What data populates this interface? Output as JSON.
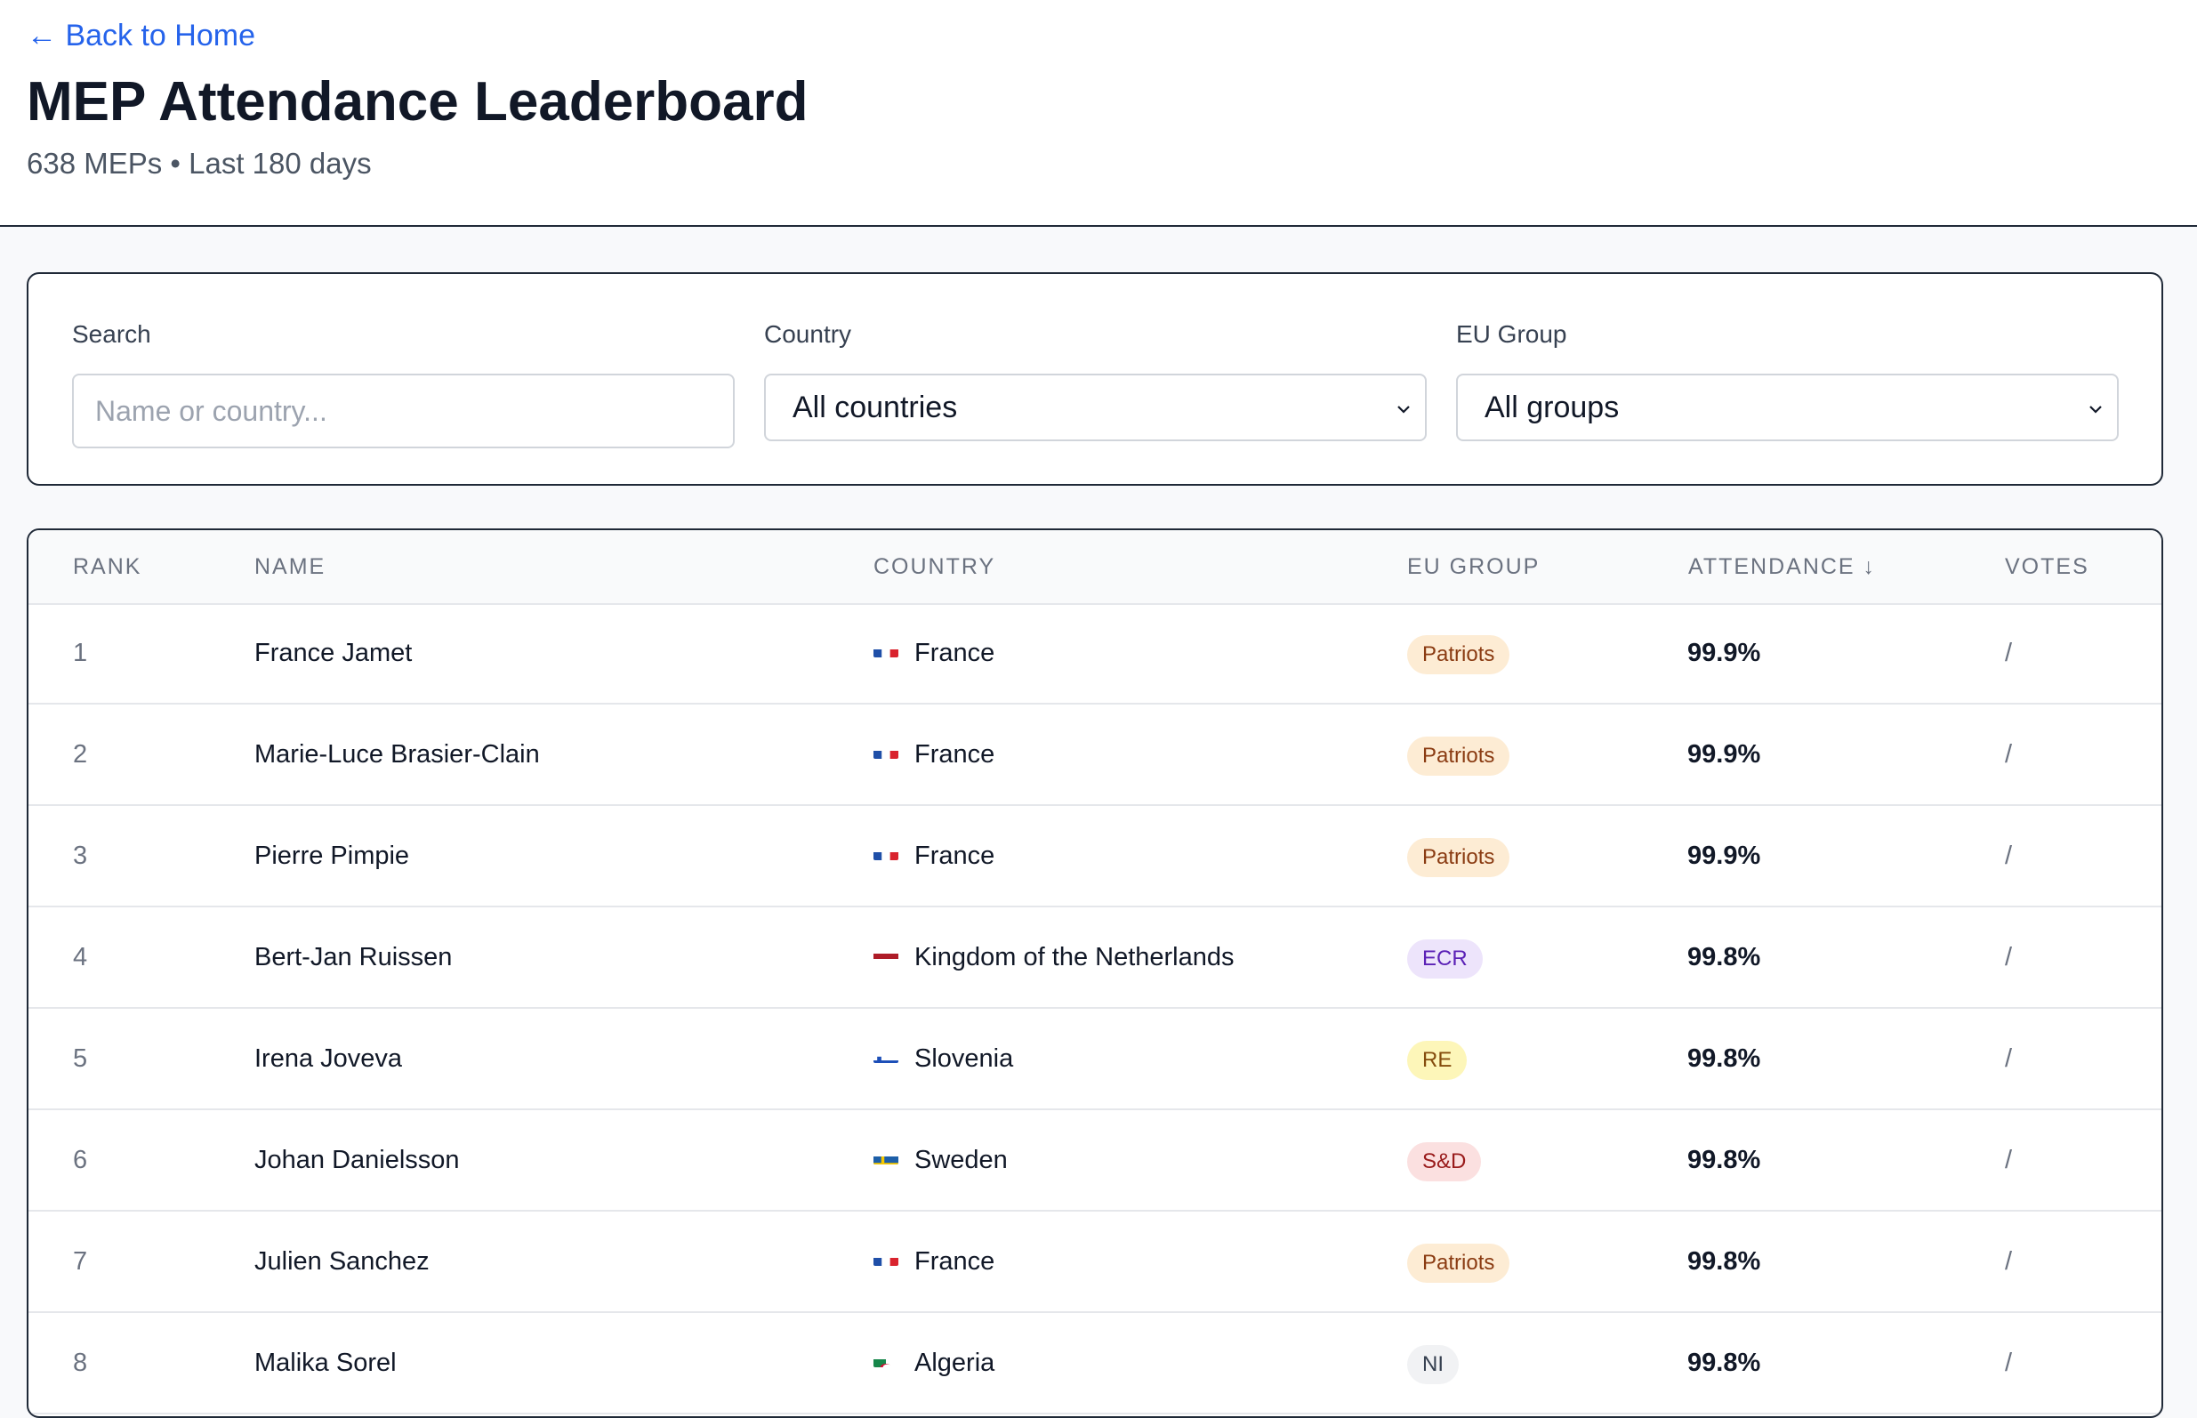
{
  "header": {
    "back_label": "← Back to Home",
    "title": "MEP Attendance Leaderboard",
    "subtitle": "638 MEPs • Last 180 days"
  },
  "filters": {
    "search_label": "Search",
    "search_placeholder": "Name or country...",
    "search_value": "",
    "country_label": "Country",
    "country_selected": "All countries",
    "group_label": "EU Group",
    "group_selected": "All groups"
  },
  "table": {
    "columns": [
      "RANK",
      "NAME",
      "COUNTRY",
      "EU GROUP",
      "ATTENDANCE ↓",
      "VOTES"
    ],
    "rows": [
      {
        "rank": "1",
        "name": "France Jamet",
        "flag": "flag-fr",
        "country": "France",
        "group": "Patriots",
        "attendance": "99.9%",
        "votes": "/"
      },
      {
        "rank": "2",
        "name": "Marie-Luce Brasier-Clain",
        "flag": "flag-fr",
        "country": "France",
        "group": "Patriots",
        "attendance": "99.9%",
        "votes": "/"
      },
      {
        "rank": "3",
        "name": "Pierre Pimpie",
        "flag": "flag-fr",
        "country": "France",
        "group": "Patriots",
        "attendance": "99.9%",
        "votes": "/"
      },
      {
        "rank": "4",
        "name": "Bert-Jan Ruissen",
        "flag": "flag-nl",
        "country": "Kingdom of the Netherlands",
        "group": "ECR",
        "attendance": "99.8%",
        "votes": "/"
      },
      {
        "rank": "5",
        "name": "Irena Joveva",
        "flag": "flag-si",
        "country": "Slovenia",
        "group": "RE",
        "attendance": "99.8%",
        "votes": "/"
      },
      {
        "rank": "6",
        "name": "Johan Danielsson",
        "flag": "flag-se",
        "country": "Sweden",
        "group": "S&D",
        "attendance": "99.8%",
        "votes": "/"
      },
      {
        "rank": "7",
        "name": "Julien Sanchez",
        "flag": "flag-fr",
        "country": "France",
        "group": "Patriots",
        "attendance": "99.8%",
        "votes": "/"
      },
      {
        "rank": "8",
        "name": "Malika Sorel",
        "flag": "flag-dz",
        "country": "Algeria",
        "group": "NI",
        "attendance": "99.8%",
        "votes": "/"
      }
    ]
  },
  "colors": {
    "link": "#2563eb",
    "badge_patriots_bg": "#fdecd4",
    "badge_patriots_text": "#8a3b12",
    "badge_ecr_bg": "#ede4fb",
    "badge_ecr_text": "#5b21b6",
    "badge_re_bg": "#fdf6b9",
    "badge_re_text": "#854d0e",
    "badge_sd_bg": "#fbe0e0",
    "badge_sd_text": "#991b1b",
    "badge_ni_bg": "#f1f2f4",
    "badge_ni_text": "#374151"
  }
}
